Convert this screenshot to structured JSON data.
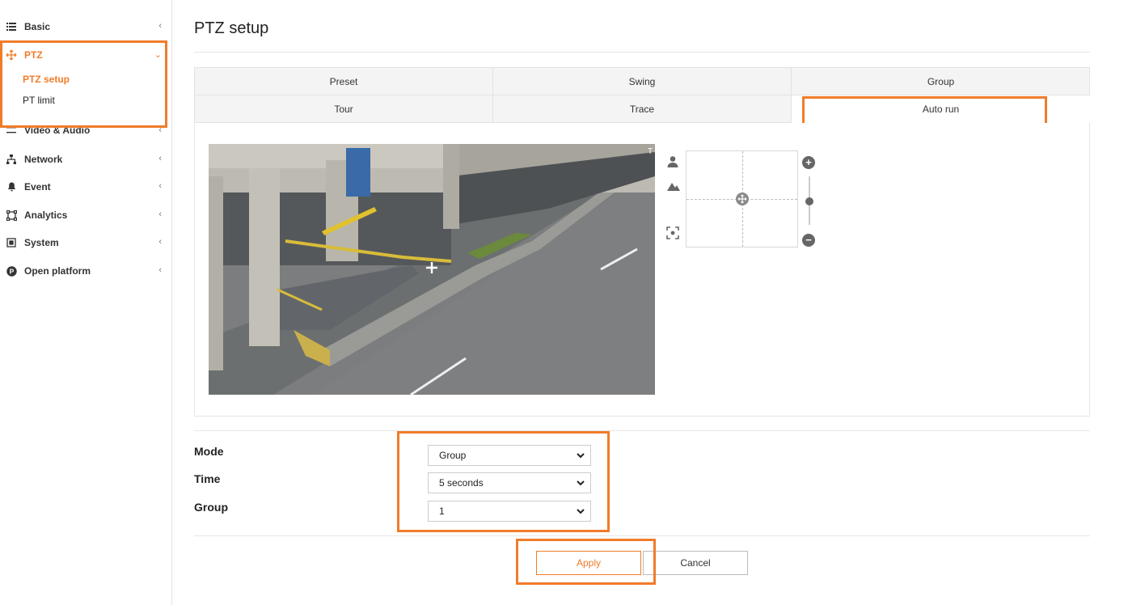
{
  "sidebar": {
    "items": [
      {
        "label": "Basic",
        "icon": "list-icon",
        "chevron": "‹"
      },
      {
        "label": "PTZ",
        "icon": "move-icon",
        "chevron": "⌄"
      },
      {
        "label": "Video & Audio",
        "icon": "sliders-icon",
        "chevron": "‹"
      },
      {
        "label": "Network",
        "icon": "network-icon",
        "chevron": "‹"
      },
      {
        "label": "Event",
        "icon": "bell-icon",
        "chevron": "‹"
      },
      {
        "label": "Analytics",
        "icon": "analytics-icon",
        "chevron": "‹"
      },
      {
        "label": "System",
        "icon": "system-icon",
        "chevron": "‹"
      },
      {
        "label": "Open platform",
        "icon": "platform-icon",
        "chevron": "‹"
      }
    ],
    "ptz_sub": [
      "PTZ setup",
      "PT limit"
    ]
  },
  "page": {
    "title": "PTZ setup"
  },
  "tabs": [
    "Preset",
    "Swing",
    "Group",
    "Tour",
    "Trace",
    "Auto run"
  ],
  "selected_tab": "Auto run",
  "form": {
    "mode": {
      "label": "Mode",
      "value": "Group"
    },
    "time": {
      "label": "Time",
      "value": "5 seconds"
    },
    "group": {
      "label": "Group",
      "value": "1"
    }
  },
  "buttons": {
    "apply": "Apply",
    "cancel": "Cancel"
  },
  "colors": {
    "accent": "#f07c2a",
    "highlight": "#f07c2a"
  }
}
